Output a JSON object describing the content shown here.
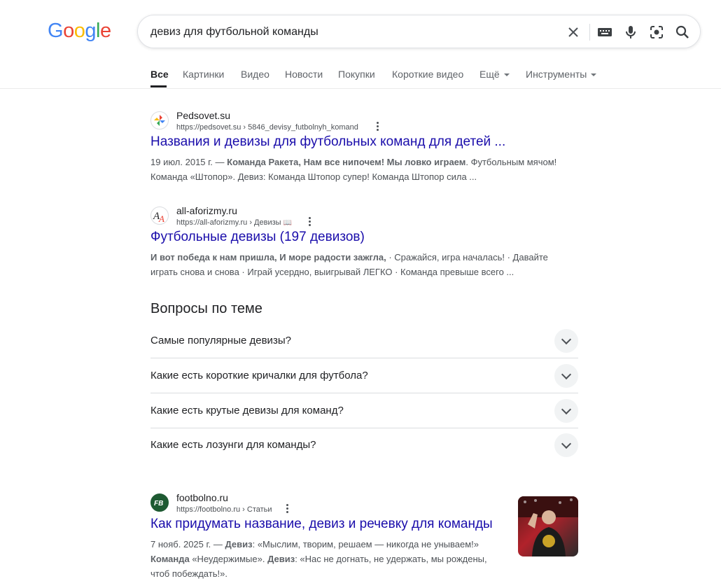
{
  "logo": {
    "letters": [
      "G",
      "o",
      "o",
      "g",
      "l",
      "e"
    ]
  },
  "search": {
    "query": "девиз для футбольной команды"
  },
  "icons": {
    "clear": "close-icon",
    "keyboard": "keyboard-icon",
    "voice": "microphone-icon",
    "lens": "camera-lens-icon",
    "search": "search-icon"
  },
  "colors": {
    "link": "#1a0dab",
    "blue": "#4285f4",
    "red": "#ea4335",
    "yellow": "#fbbc05",
    "green": "#34a853"
  },
  "tabs": [
    {
      "label": "Все"
    },
    {
      "label": "Картинки"
    },
    {
      "label": "Видео"
    },
    {
      "label": "Новости"
    },
    {
      "label": "Покупки"
    },
    {
      "label": "Короткие видео"
    },
    {
      "label": "Ещё"
    },
    {
      "label": "Инструменты"
    }
  ],
  "results": [
    {
      "site": "Pedsovet.su",
      "url": "https://pedsovet.su › 5846_devisy_futbolnyh_komand",
      "title": "Названия и девизы для футбольных команд для детей ...",
      "snippet_date": "19 июл. 2015 г. — ",
      "snippet_bold": "Команда Ракета, Нам все нипочем! Мы ловко играем",
      "snippet_rest": ". Футбольным мячом! Команда «Штопор». Девиз: Команда Штопор супер! Команда Штопор сила ..."
    },
    {
      "site": "all-aforizmy.ru",
      "url": "https://all-aforizmy.ru › Девизы",
      "badge": "📖",
      "title": "Футбольные девизы (197 девизов)",
      "snippet_bold": "И вот победа к нам пришла, И море радости зажгла,",
      "snippet_rest": " · Сражайся, игра началась! · Давайте играть снова и снова · Играй усердно, выигрывай ЛЕГКО · Команда превыше всего ..."
    },
    {
      "site": "footbolno.ru",
      "url": "https://footbolno.ru › Статьи",
      "favicon_text": "FB",
      "title": "Как придумать название, девиз и речевку для команды",
      "snippet_date": "7 нояб. 2025 г. — ",
      "snippet_bold1": "Девиз",
      "snippet_mid1": ": «Мыслим, творим, решаем — никогда не унываем!» ",
      "snippet_bold2": "Команда",
      "snippet_mid2": " «Неудержимые». ",
      "snippet_bold3": "Девиз",
      "snippet_mid3": ": «Нас не догнать, не удержать, мы рождены, чтоб побеждать!»."
    }
  ],
  "paa": {
    "title": "Вопросы по теме",
    "questions": [
      "Самые популярные девизы?",
      "Какие есть короткие кричалки для футбола?",
      "Какие есть крутые девизы для команд?",
      "Какие есть лозунги для команды?"
    ]
  }
}
